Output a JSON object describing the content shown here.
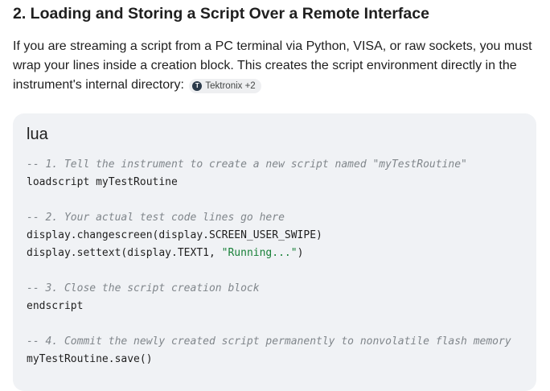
{
  "section": {
    "heading": "2. Loading and Storing a Script Over a Remote Interface",
    "paragraph": "If you are streaming a script from a PC terminal via Python, VISA, or raw sockets, you must wrap your lines inside a creation block. This creates the script environment directly in the instrument's internal directory:",
    "source_chip": {
      "label": "Tektronix +2",
      "icon": "tektronix-logo-icon"
    }
  },
  "code_block": {
    "language": "lua",
    "lines": [
      {
        "parts": [
          {
            "type": "comment",
            "text": "-- 1. Tell the instrument to create a new script named \"myTestRoutine\""
          }
        ]
      },
      {
        "parts": [
          {
            "type": "code",
            "text": "loadscript myTestRoutine"
          }
        ]
      },
      {
        "parts": []
      },
      {
        "parts": [
          {
            "type": "comment",
            "text": "-- 2. Your actual test code lines go here"
          }
        ]
      },
      {
        "parts": [
          {
            "type": "code",
            "text": "display.changescreen(display.SCREEN_USER_SWIPE)"
          }
        ]
      },
      {
        "parts": [
          {
            "type": "code",
            "text": "display.settext(display.TEXT1, "
          },
          {
            "type": "string",
            "text": "\"Running...\""
          },
          {
            "type": "code",
            "text": ")"
          }
        ]
      },
      {
        "parts": []
      },
      {
        "parts": [
          {
            "type": "comment",
            "text": "-- 3. Close the script creation block"
          }
        ]
      },
      {
        "parts": [
          {
            "type": "code",
            "text": "endscript"
          }
        ]
      },
      {
        "parts": []
      },
      {
        "parts": [
          {
            "type": "comment",
            "text": "-- 4. Commit the newly created script permanently to nonvolatile flash memory"
          }
        ]
      },
      {
        "parts": [
          {
            "type": "code",
            "text": "myTestRoutine.save()"
          }
        ]
      }
    ]
  }
}
